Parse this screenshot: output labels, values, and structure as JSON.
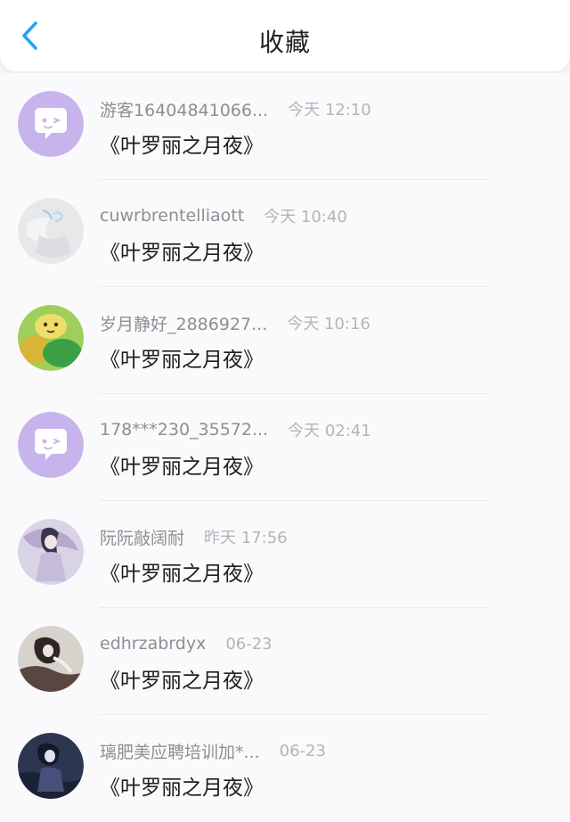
{
  "header": {
    "title": "收藏",
    "back_icon": "chevron-left-icon",
    "accent_color": "#2aa2f0"
  },
  "favorites": [
    {
      "user": "游客16404841066...",
      "time": "今天 12:10",
      "title": "《叶罗丽之月夜》",
      "avatar": "default-chat-avatar"
    },
    {
      "user": "cuwrbrentelliaott",
      "time": "今天 10:40",
      "title": "《叶罗丽之月夜》",
      "avatar": "photo-avatar"
    },
    {
      "user": "岁月静好_2886927...",
      "time": "今天 10:16",
      "title": "《叶罗丽之月夜》",
      "avatar": "photo-avatar"
    },
    {
      "user": "178***230_35572...",
      "time": "今天 02:41",
      "title": "《叶罗丽之月夜》",
      "avatar": "default-chat-avatar"
    },
    {
      "user": "阮阮敲阔耐",
      "time": "昨天 17:56",
      "title": "《叶罗丽之月夜》",
      "avatar": "photo-avatar"
    },
    {
      "user": "edhrzabrdyx",
      "time": "06-23",
      "title": "《叶罗丽之月夜》",
      "avatar": "photo-avatar"
    },
    {
      "user": "璃肥美应聘培训加*...",
      "time": "06-23",
      "title": "《叶罗丽之月夜》",
      "avatar": "photo-avatar"
    }
  ]
}
